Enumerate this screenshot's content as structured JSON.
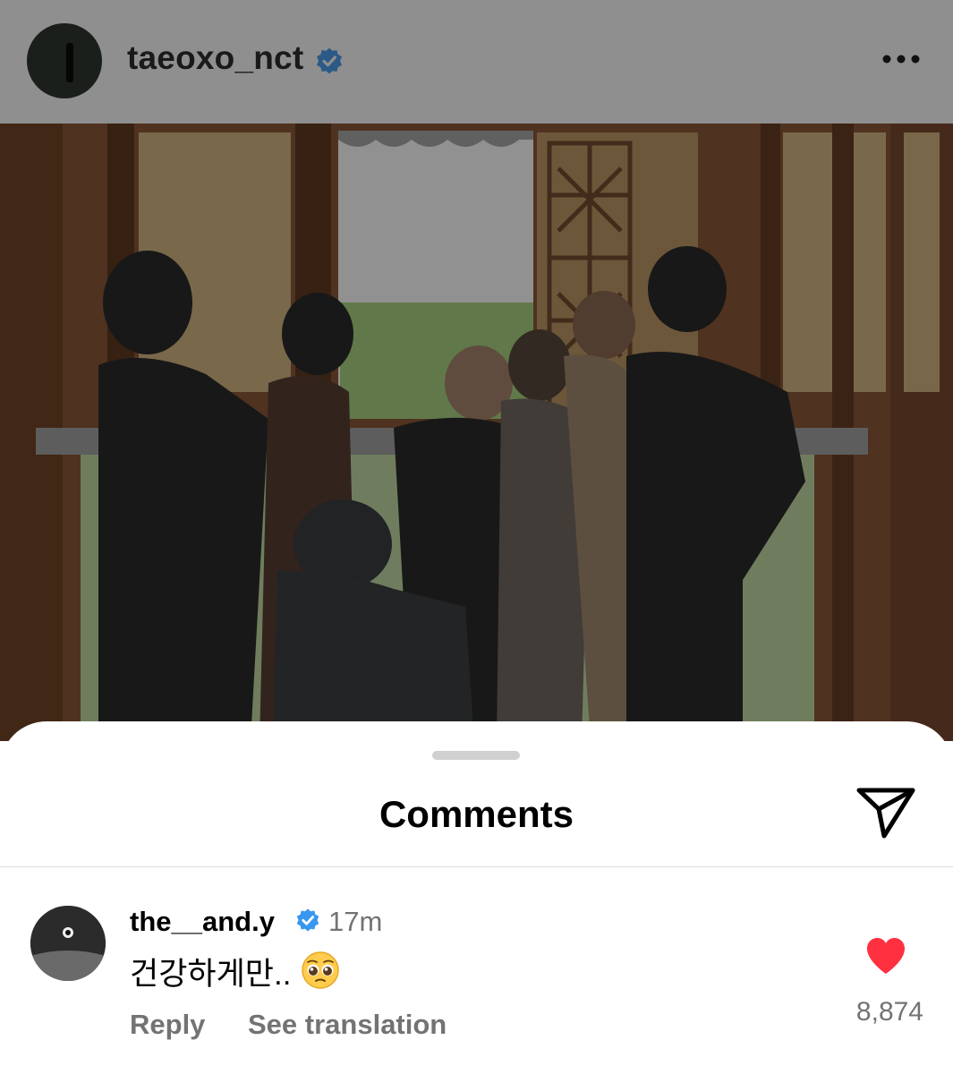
{
  "post": {
    "username": "taeoxo_nct",
    "verified": true,
    "more_icon": "more-horizontal-icon"
  },
  "comments_sheet": {
    "title": "Comments",
    "share_icon": "send-paper-plane-icon"
  },
  "comments": [
    {
      "username": "the__and.y",
      "verified": true,
      "time": "17m",
      "text": "건강하게만..",
      "emoji": "pleading-face",
      "reply_label": "Reply",
      "translate_label": "See translation",
      "liked": true,
      "like_count": "8,874"
    }
  ],
  "colors": {
    "verified_blue": "#3897f0",
    "like_red": "#ff3040",
    "muted_gray": "#737373",
    "dim_overlay": "#8f8f8f"
  }
}
